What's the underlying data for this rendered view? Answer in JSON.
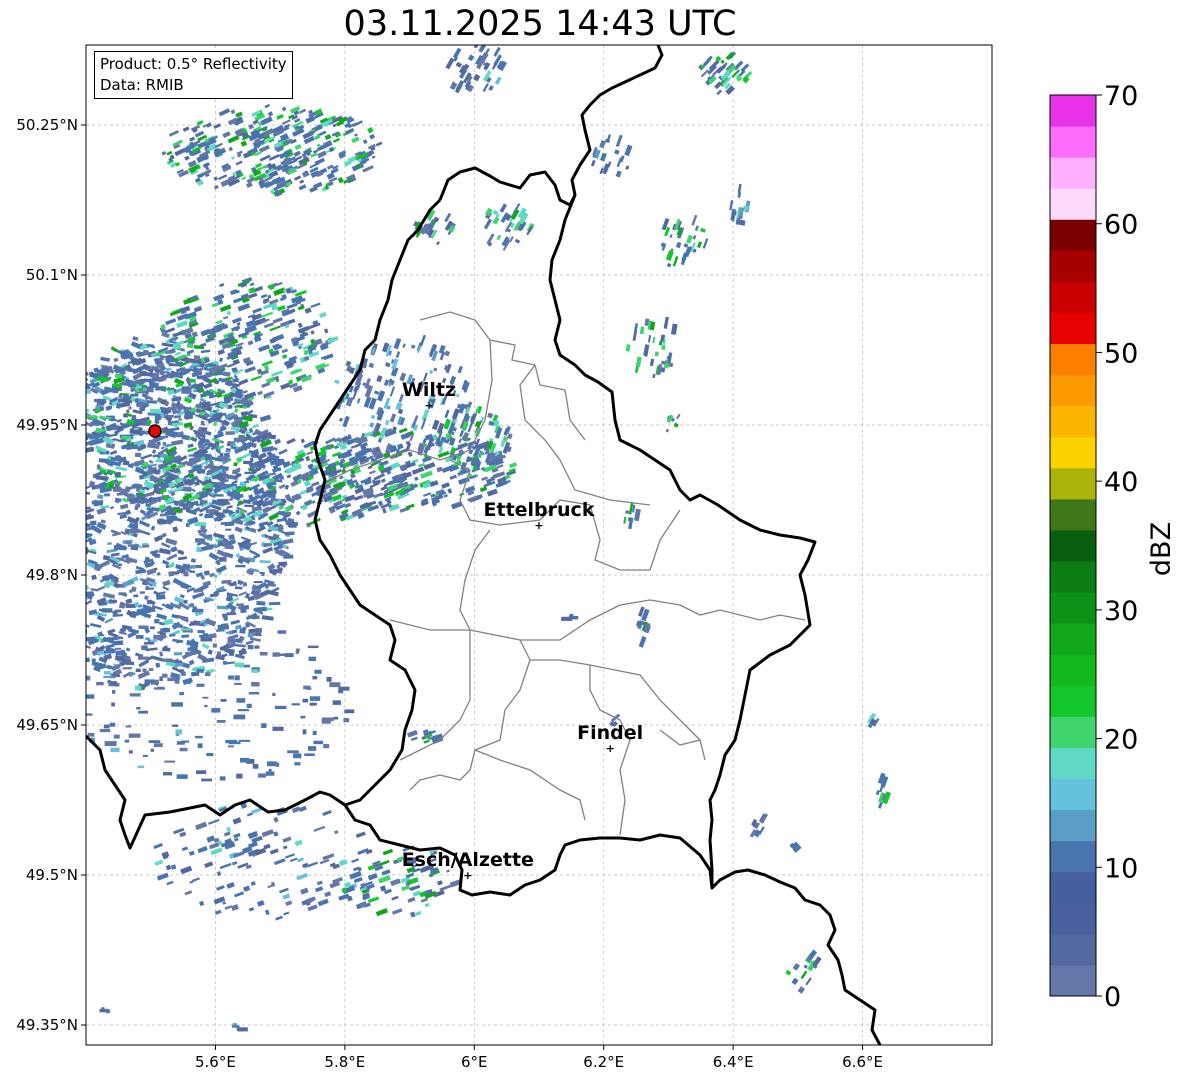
{
  "title": "03.11.2025 14:43 UTC",
  "info": {
    "product": "Product: 0.5° Reflectivity",
    "source": "Data: RMIB"
  },
  "axes": {
    "lon_ticks": [
      "5.6°E",
      "5.8°E",
      "6°E",
      "6.2°E",
      "6.4°E",
      "6.6°E"
    ],
    "lat_ticks": [
      "50.25°N",
      "50.1°N",
      "49.95°N",
      "49.8°N",
      "49.65°N",
      "49.5°N",
      "49.35°N"
    ]
  },
  "cities": [
    {
      "name": "Wiltz",
      "lon": 5.93,
      "lat": 49.97
    },
    {
      "name": "Ettelbruck",
      "lon": 6.1,
      "lat": 49.85
    },
    {
      "name": "Findel",
      "lon": 6.21,
      "lat": 49.627
    },
    {
      "name": "Esch/Alzette",
      "lon": 5.99,
      "lat": 49.5
    }
  ],
  "radar_site": {
    "lon": 5.505,
    "lat": 49.914
  },
  "colorbar": {
    "label": "dBZ",
    "min": 0,
    "max": 70,
    "ticks": [
      "0",
      "10",
      "20",
      "30",
      "40",
      "50",
      "60",
      "70"
    ],
    "colors": [
      "#6577a8",
      "#5468a0",
      "#4a5f9e",
      "#4460a0",
      "#4a74ad",
      "#5a9ec7",
      "#65c2dc",
      "#5fd8c5",
      "#3fd46e",
      "#13c72a",
      "#12b81c",
      "#10a81a",
      "#0e9216",
      "#0c7c14",
      "#095e10",
      "#3f7818",
      "#aab50c",
      "#fcd300",
      "#fdb600",
      "#fd9a00",
      "#fd7f00",
      "#e70000",
      "#c80000",
      "#a80000",
      "#7b0000",
      "#ffdaff",
      "#ffb0ff",
      "#ff6dff",
      "#e832e8"
    ]
  }
}
